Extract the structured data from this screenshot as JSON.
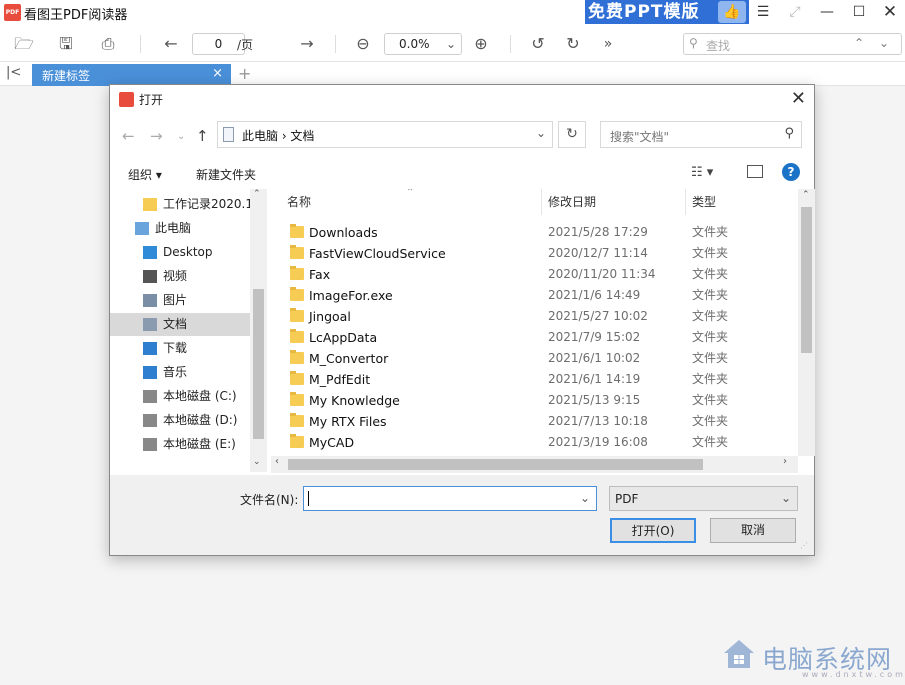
{
  "app": {
    "logo_text": "PDF",
    "title": "看图王PDF阅读器",
    "promo": "免费PPT模版"
  },
  "toolbar": {
    "page_value": "0",
    "page_total": "/页",
    "zoom_value": "0.0%",
    "search_placeholder": "查找"
  },
  "tabs": [
    {
      "label": "新建标签",
      "active": true
    }
  ],
  "dialog": {
    "title": "打开",
    "breadcrumbs": "此电脑  ›  文档",
    "search_placeholder": "搜索\"文档\"",
    "commands": {
      "organize": "组织 ▾",
      "new_folder": "新建文件夹"
    },
    "nav_items": [
      {
        "label": "工作记录2020.1",
        "icon": "folder-icon",
        "indent": 1
      },
      {
        "label": "此电脑",
        "icon": "computer-icon",
        "indent": 0
      },
      {
        "label": "Desktop",
        "icon": "desktop-icon",
        "indent": 1
      },
      {
        "label": "视频",
        "icon": "video-icon",
        "indent": 1
      },
      {
        "label": "图片",
        "icon": "picture-icon",
        "indent": 1
      },
      {
        "label": "文档",
        "icon": "document-icon",
        "indent": 1,
        "selected": true
      },
      {
        "label": "下载",
        "icon": "download-icon",
        "indent": 1
      },
      {
        "label": "音乐",
        "icon": "music-icon",
        "indent": 1
      },
      {
        "label": "本地磁盘 (C:)",
        "icon": "drive-icon",
        "indent": 1
      },
      {
        "label": "本地磁盘 (D:)",
        "icon": "drive-icon",
        "indent": 1
      },
      {
        "label": "本地磁盘 (E:)",
        "icon": "drive-icon",
        "indent": 1
      }
    ],
    "columns": {
      "name": "名称",
      "date": "修改日期",
      "type": "类型"
    },
    "files": [
      {
        "name": "Downloads",
        "date": "2021/5/28 17:29",
        "type": "文件夹"
      },
      {
        "name": "FastViewCloudService",
        "date": "2020/12/7 11:14",
        "type": "文件夹"
      },
      {
        "name": "Fax",
        "date": "2020/11/20 11:34",
        "type": "文件夹"
      },
      {
        "name": "ImageFor.exe",
        "date": "2021/1/6 14:49",
        "type": "文件夹"
      },
      {
        "name": "Jingoal",
        "date": "2021/5/27 10:02",
        "type": "文件夹"
      },
      {
        "name": "LcAppData",
        "date": "2021/7/9 15:02",
        "type": "文件夹"
      },
      {
        "name": "M_Convertor",
        "date": "2021/6/1 10:02",
        "type": "文件夹"
      },
      {
        "name": "M_PdfEdit",
        "date": "2021/6/1 14:19",
        "type": "文件夹"
      },
      {
        "name": "My Knowledge",
        "date": "2021/5/13 9:15",
        "type": "文件夹"
      },
      {
        "name": "My RTX Files",
        "date": "2021/7/13 10:18",
        "type": "文件夹"
      },
      {
        "name": "MyCAD",
        "date": "2021/3/19 16:08",
        "type": "文件夹"
      }
    ],
    "filename_label": "文件名(N):",
    "filename_value": "",
    "filetype_value": "PDF",
    "open_button": "打开(O)",
    "cancel_button": "取消"
  },
  "watermark": {
    "text": "电脑系统网",
    "url": "www.dnxtw.com"
  }
}
